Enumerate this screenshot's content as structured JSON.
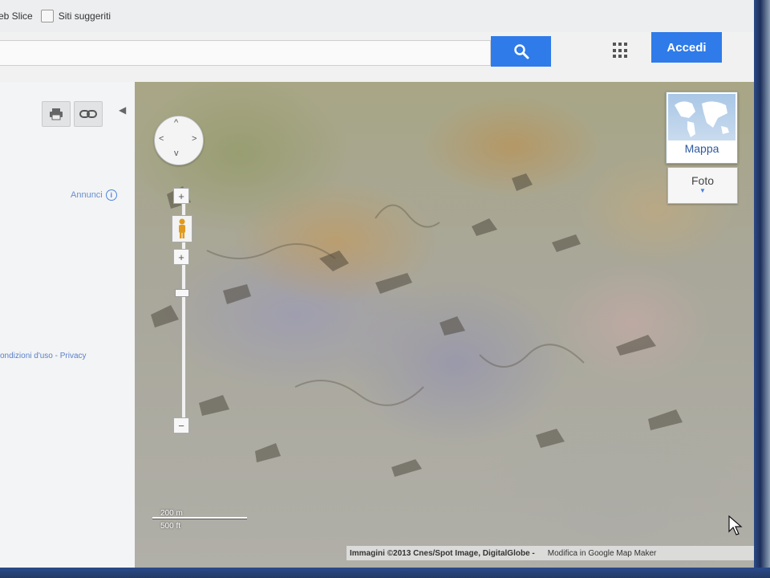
{
  "bookmarks": {
    "items": [
      {
        "label": "eb Slice"
      },
      {
        "label": "Siti suggeriti"
      }
    ]
  },
  "header": {
    "search_value": "",
    "login_label": "Accedi"
  },
  "left_panel": {
    "ad_label": "Annunci",
    "terms_text": "ondizioni d'uso - Privacy"
  },
  "map": {
    "map_type_label": "Mappa",
    "photo_label": "Foto",
    "scale_metric": "200 m",
    "scale_imperial": "500 ft",
    "attribution": "Immagini ©2013 Cnes/Spot Image, DigitalGlobe -",
    "edit_link": "Modifica in Google Map Maker"
  }
}
